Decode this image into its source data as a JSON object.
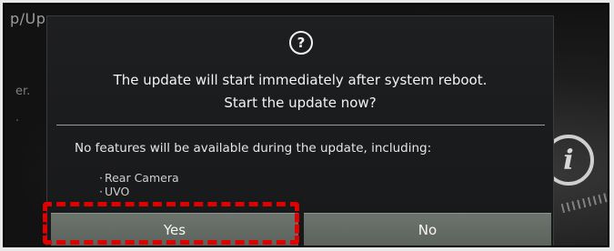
{
  "background": {
    "title_fragment": "p/Up",
    "side_text_1": "er.",
    "side_text_2": "."
  },
  "dialog": {
    "icon": "question-circle-icon",
    "icon_glyph": "?",
    "message_line1": "The update will start immediately after system reboot.",
    "message_line2": "Start the update now?",
    "note": "No features will be available during the update, including:",
    "features": [
      "Rear Camera",
      "UVO"
    ],
    "yes_label": "Yes",
    "no_label": "No"
  },
  "annotation": {
    "highlight_color": "#e00000",
    "highlight_target": "yes-button"
  },
  "decor": {
    "info_icon": "info-icon",
    "info_glyph": "i"
  }
}
